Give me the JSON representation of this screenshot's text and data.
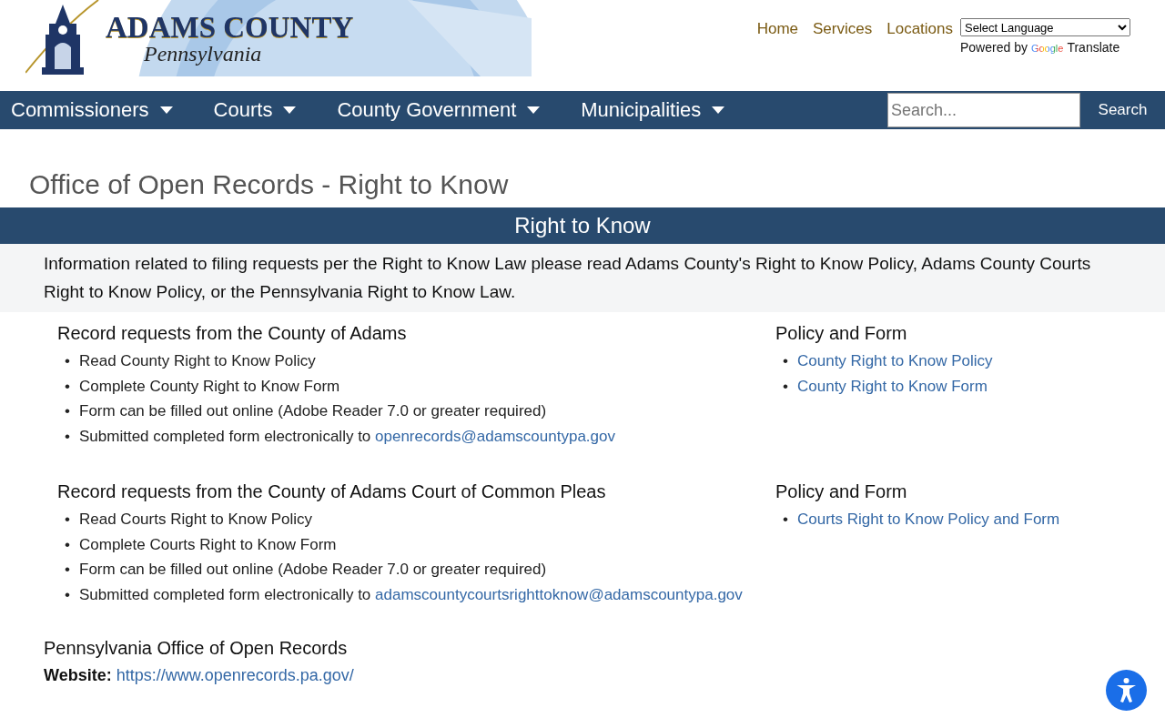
{
  "logo": {
    "title": "ADAMS COUNTY",
    "subtitle": "Pennsylvania"
  },
  "top_links": [
    "Home",
    "Services",
    "Locations"
  ],
  "language_select": {
    "value": "Select Language"
  },
  "translate": {
    "prefix": "Powered by",
    "brand": "Google",
    "suffix": "Translate"
  },
  "nav": {
    "items": [
      {
        "label": "Commissioners"
      },
      {
        "label": "Courts"
      },
      {
        "label": "County Government"
      },
      {
        "label": "Municipalities"
      }
    ],
    "search": {
      "placeholder": "Search...",
      "button": "Search"
    }
  },
  "page_title": "Office of Open Records - Right to Know",
  "banner": "Right to Know",
  "intro": "Information related to filing requests per the Right to Know Law please read Adams County's Right to Know Policy, Adams County Courts Right to Know Policy, or the Pennsylvania Right to Know Law.",
  "sections": [
    {
      "heading": "Record requests from the County of Adams",
      "items": [
        {
          "bullet": "•",
          "text": "Read County Right to Know Policy"
        },
        {
          "bullet": "•",
          "text": "Complete County Right to Know Form"
        },
        {
          "bullet": "•",
          "text": "Form can be filled out online (Adobe Reader 7.0 or greater required)"
        },
        {
          "bullet": "•",
          "text": "Submitted completed form electronically to",
          "link": "openrecords@adamscountypa.gov"
        }
      ],
      "side": {
        "heading": "Policy and Form",
        "links": [
          {
            "bullet": "•",
            "text": "County Right to Know Policy"
          },
          {
            "bullet": "•",
            "text": "County Right to Know Form"
          }
        ]
      }
    },
    {
      "heading": "Record requests from the County of Adams Court of Common Pleas",
      "items": [
        {
          "bullet": "•",
          "text": "Read Courts Right to Know Policy"
        },
        {
          "bullet": "•",
          "text": "Complete Courts Right to Know Form"
        },
        {
          "bullet": "•",
          "text": "Form can be filled out online (Adobe Reader 7.0 or greater required)"
        },
        {
          "bullet": "•",
          "text": "Submitted completed form electronically to",
          "link": "adamscountycourtsrighttoknow@adamscountypa.gov"
        }
      ],
      "side": {
        "heading": "Policy and Form",
        "links": [
          {
            "bullet": "•",
            "text": "Courts Right to Know Policy and Form"
          }
        ]
      }
    }
  ],
  "contact": {
    "heading": "Pennsylvania Office of Open Records",
    "website_label": "Website:",
    "website_url": "https://www.openrecords.pa.gov/"
  }
}
